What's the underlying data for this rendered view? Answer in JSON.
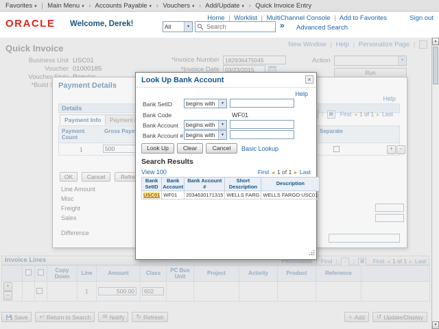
{
  "icons": {
    "caret": "▾",
    "crumb_sep": "›",
    "pipe": "|",
    "search_go": "»",
    "close": "×",
    "prev": "◄",
    "next": "►",
    "plus": "+",
    "minus": "−",
    "return": "↩",
    "notify": "✉",
    "refresh": "↻",
    "add": "+",
    "update": "↺",
    "up_arrow": "▲",
    "down_arrow": "▼",
    "download": "↓",
    "grid": "▦"
  },
  "breadcrumb": {
    "items": [
      "Favorites",
      "Main Menu",
      "Accounts Payable",
      "Vouchers",
      "Add/Update",
      "Quick Invoice Entry"
    ]
  },
  "header": {
    "logo": "ORACLE",
    "welcome": "Welcome, Derek!",
    "search_scope": "All",
    "search_placeholder": "Search",
    "links": [
      "Home",
      "Worklist",
      "MultiChannel Console",
      "Add to Favorites"
    ],
    "sign_out": "Sign out",
    "advanced_search": "Advanced Search"
  },
  "page": {
    "title": "Quick Invoice",
    "top_links": [
      "New Window",
      "Help",
      "Personalize Page"
    ],
    "labels": {
      "business_unit": "Business Unit",
      "voucher": "Voucher",
      "voucher_style": "Voucher Style",
      "build_status": "*Build Status",
      "invoice_number": "*Invoice Number",
      "invoice_date": "*Invoice Date",
      "action": "Action"
    },
    "values": {
      "business_unit": "USC01",
      "voucher": "01000185",
      "voucher_style": "Regular",
      "invoice_number": "182936475045",
      "invoice_date": "03/23/2015"
    },
    "run_button": "Run"
  },
  "payment_details": {
    "title": "Payment Details",
    "help": "Help",
    "group_title": "Details",
    "tabs": [
      "Payment Info",
      "Payment Hold"
    ],
    "pagination": {
      "first": "First",
      "page": "1 of 1",
      "last": "Last"
    },
    "columns": {
      "count": "Payment Count",
      "gross": "Gross Payment Amount",
      "separate": "Separate"
    },
    "row": {
      "count": "1",
      "gross": "500"
    },
    "buttons": {
      "ok": "OK",
      "cancel": "Cancel",
      "refresh": "Refresh"
    },
    "field_labels": [
      "Line Amount",
      "Misc",
      "Freight",
      "Sales"
    ],
    "difference_label": "Difference"
  },
  "lookup": {
    "title": "Look Up Bank Account",
    "help": "Help",
    "fields": [
      {
        "label": "Bank SetID",
        "op": "begins with",
        "value": ""
      },
      {
        "label": "Bank Code",
        "op": "",
        "value": "WF01"
      },
      {
        "label": "Bank Account",
        "op": "begins with",
        "value": ""
      },
      {
        "label": "Bank Account #",
        "op": "begins with",
        "value": ""
      }
    ],
    "buttons": {
      "look_up": "Look Up",
      "clear": "Clear",
      "cancel": "Cancel"
    },
    "basic_lookup": "Basic Lookup",
    "results": {
      "heading": "Search Results",
      "view": "View 100",
      "pagination": {
        "first": "First",
        "page": "1 of 1",
        "last": "Last"
      },
      "table": {
        "headers": [
          "Bank SetID",
          "Bank Account",
          "Bank Account #",
          "Short Description",
          "Description"
        ],
        "rows": [
          [
            "USC01",
            "WF01",
            "2034630171315",
            "WELLS FARG",
            "WELLS FARGO USC01"
          ]
        ]
      }
    }
  },
  "invoice_lines": {
    "title": "Invoice Lines",
    "links": [
      "Personalize",
      "Find"
    ],
    "pagination": {
      "first": "First",
      "page": "1 of 1",
      "last": "Last"
    },
    "headers": [
      "Copy Down",
      "Line",
      "Amount",
      "Class",
      "PC Bus Unit",
      "Project",
      "Activity",
      "Product",
      "Reference"
    ],
    "row": {
      "line": "1",
      "amount": "500.00",
      "class_code": "602"
    }
  },
  "toolbar": {
    "save": "Save",
    "return_to_search": "Return to Search",
    "notify": "Notify",
    "refresh": "Refresh",
    "add": "Add",
    "update_display": "Update/Display"
  }
}
